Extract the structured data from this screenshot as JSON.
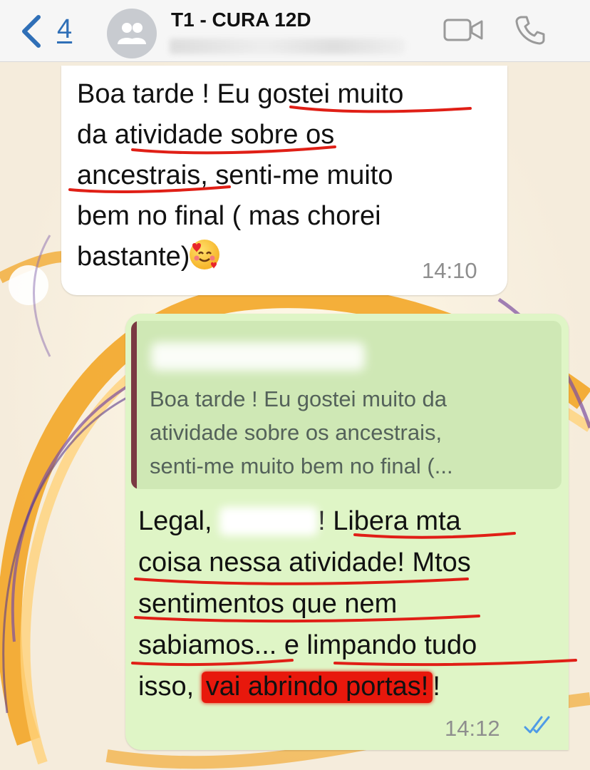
{
  "header": {
    "back_count": "4",
    "title": "T1 - CURA 12D"
  },
  "messages": [
    {
      "direction": "incoming",
      "lines": [
        "Boa tarde ! Eu gostei muito",
        "da atividade sobre os",
        "ancestrais, senti-me muito",
        "bem no final ( mas chorei",
        "bastante)"
      ],
      "emoji": "smiling-face-with-hearts",
      "time": "14:10"
    },
    {
      "direction": "outgoing",
      "quoted_text": [
        "Boa tarde ! Eu gostei muito da",
        "atividade sobre os ancestrais,",
        "senti-me muito bem no final (..."
      ],
      "line1_a": "Legal,",
      "line1_b": "! Libera mta",
      "line2": "coisa nessa atividade! Mtos",
      "line3": "sentimentos que nem",
      "line4": "sabiamos... e limpando tudo",
      "line5_a": "isso,",
      "line5_highlight": "vai abrindo portas!",
      "line5_c": "!",
      "time": "14:12",
      "status_icon": "double-check-read-icon"
    }
  ],
  "colors": {
    "accent": "#2f6fb7",
    "outgoing_bubble": "#dff5c6",
    "quote_bar": "#7a3942",
    "annotation_red": "#e8180c"
  }
}
